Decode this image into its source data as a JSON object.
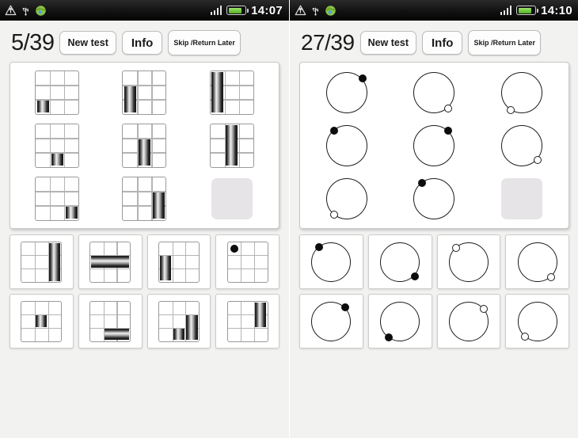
{
  "panels": [
    {
      "id": "left-panel",
      "statusbar": {
        "icons": [
          "alert-upload-icon",
          "usb-icon",
          "android-globe-icon"
        ],
        "signal_label": "signal-bars-icon",
        "battery_label": "battery-icon",
        "time": "14:07"
      },
      "header": {
        "score": "5/39",
        "new_test_label": "New test",
        "info_label": "Info",
        "skip_line1": "Skip /",
        "skip_line2": "Return Later"
      },
      "puzzle_type": "grid-bars",
      "matrix": [
        {
          "kind": "grid",
          "bars": [
            {
              "col": 0,
              "rowStart": 2,
              "rowEnd": 3,
              "orient": "v"
            }
          ]
        },
        {
          "kind": "grid",
          "bars": [
            {
              "col": 0,
              "rowStart": 1,
              "rowEnd": 3,
              "orient": "v"
            }
          ]
        },
        {
          "kind": "grid",
          "bars": [
            {
              "col": 0,
              "rowStart": 0,
              "rowEnd": 3,
              "orient": "v"
            }
          ]
        },
        {
          "kind": "grid",
          "bars": [
            {
              "col": 1,
              "rowStart": 2,
              "rowEnd": 3,
              "orient": "v"
            }
          ]
        },
        {
          "kind": "grid",
          "bars": [
            {
              "col": 1,
              "rowStart": 1,
              "rowEnd": 3,
              "orient": "v"
            }
          ]
        },
        {
          "kind": "grid",
          "bars": [
            {
              "col": 1,
              "rowStart": 0,
              "rowEnd": 3,
              "orient": "v"
            }
          ]
        },
        {
          "kind": "grid",
          "bars": [
            {
              "col": 2,
              "rowStart": 2,
              "rowEnd": 3,
              "orient": "v"
            }
          ]
        },
        {
          "kind": "grid",
          "bars": [
            {
              "col": 2,
              "rowStart": 1,
              "rowEnd": 3,
              "orient": "v"
            }
          ]
        },
        {
          "kind": "blank"
        }
      ],
      "options": [
        {
          "kind": "grid",
          "bars": [
            {
              "col": 2,
              "rowStart": 0,
              "rowEnd": 3,
              "orient": "v"
            }
          ]
        },
        {
          "kind": "grid",
          "bars": [
            {
              "row": 1,
              "colStart": 0,
              "colEnd": 3,
              "orient": "h"
            }
          ]
        },
        {
          "kind": "grid",
          "bars": [
            {
              "col": 0,
              "rowStart": 1,
              "rowEnd": 3,
              "orient": "v"
            }
          ]
        },
        {
          "kind": "grid",
          "dots": [
            {
              "col": 0,
              "row": 0,
              "style": "filled"
            }
          ]
        },
        {
          "kind": "grid",
          "bars": [
            {
              "col": 1,
              "rowStart": 1,
              "rowEnd": 2,
              "orient": "v"
            }
          ]
        },
        {
          "kind": "grid",
          "bars": [
            {
              "row": 2,
              "colStart": 1,
              "colEnd": 3,
              "orient": "h"
            }
          ]
        },
        {
          "kind": "grid",
          "bars": [
            {
              "col": 1,
              "rowStart": 2,
              "rowEnd": 3,
              "orient": "v"
            },
            {
              "col": 2,
              "rowStart": 1,
              "rowEnd": 3,
              "orient": "v"
            }
          ]
        },
        {
          "kind": "grid",
          "bars": [
            {
              "col": 2,
              "rowStart": 0,
              "rowEnd": 2,
              "orient": "v"
            }
          ]
        }
      ]
    },
    {
      "id": "right-panel",
      "statusbar": {
        "icons": [
          "alert-upload-icon",
          "usb-icon",
          "android-globe-icon"
        ],
        "signal_label": "signal-bars-icon",
        "battery_label": "battery-icon",
        "time": "14:10"
      },
      "header": {
        "score": "27/39",
        "new_test_label": "New test",
        "info_label": "Info",
        "skip_line1": "Skip /",
        "skip_line2": "Return Later"
      },
      "puzzle_type": "circle-dots",
      "matrix": [
        {
          "kind": "circle",
          "dot": {
            "angle": 45,
            "style": "filled"
          }
        },
        {
          "kind": "circle",
          "dot": {
            "angle": 140,
            "style": "hollow"
          }
        },
        {
          "kind": "circle",
          "dot": {
            "angle": 215,
            "style": "hollow"
          }
        },
        {
          "kind": "circle",
          "dot": {
            "angle": 318,
            "style": "filled"
          }
        },
        {
          "kind": "circle",
          "dot": {
            "angle": 40,
            "style": "filled"
          }
        },
        {
          "kind": "circle",
          "dot": {
            "angle": 132,
            "style": "hollow"
          }
        },
        {
          "kind": "circle",
          "dot": {
            "angle": 220,
            "style": "hollow"
          }
        },
        {
          "kind": "circle",
          "dot": {
            "angle": 322,
            "style": "filled"
          }
        },
        {
          "kind": "blank"
        }
      ],
      "options": [
        {
          "kind": "circle",
          "dot": {
            "angle": 320,
            "style": "filled"
          }
        },
        {
          "kind": "circle",
          "dot": {
            "angle": 135,
            "style": "filled"
          }
        },
        {
          "kind": "circle",
          "dot": {
            "angle": 318,
            "style": "hollow"
          }
        },
        {
          "kind": "circle",
          "dot": {
            "angle": 138,
            "style": "hollow"
          }
        },
        {
          "kind": "circle",
          "dot": {
            "angle": 42,
            "style": "filled"
          }
        },
        {
          "kind": "circle",
          "dot": {
            "angle": 218,
            "style": "filled"
          }
        },
        {
          "kind": "circle",
          "dot": {
            "angle": 48,
            "style": "hollow"
          }
        },
        {
          "kind": "circle",
          "dot": {
            "angle": 222,
            "style": "hollow"
          }
        }
      ]
    }
  ],
  "colors": {
    "statusbar_bg": "#0a0a0a",
    "battery_green": "#6fc22c",
    "app_bg": "#f2f2f0",
    "panel_bg": "#ffffff",
    "blank_slot": "#e6e4e6",
    "bar_dark": "#111111",
    "stroke": "#1c1c1c"
  }
}
